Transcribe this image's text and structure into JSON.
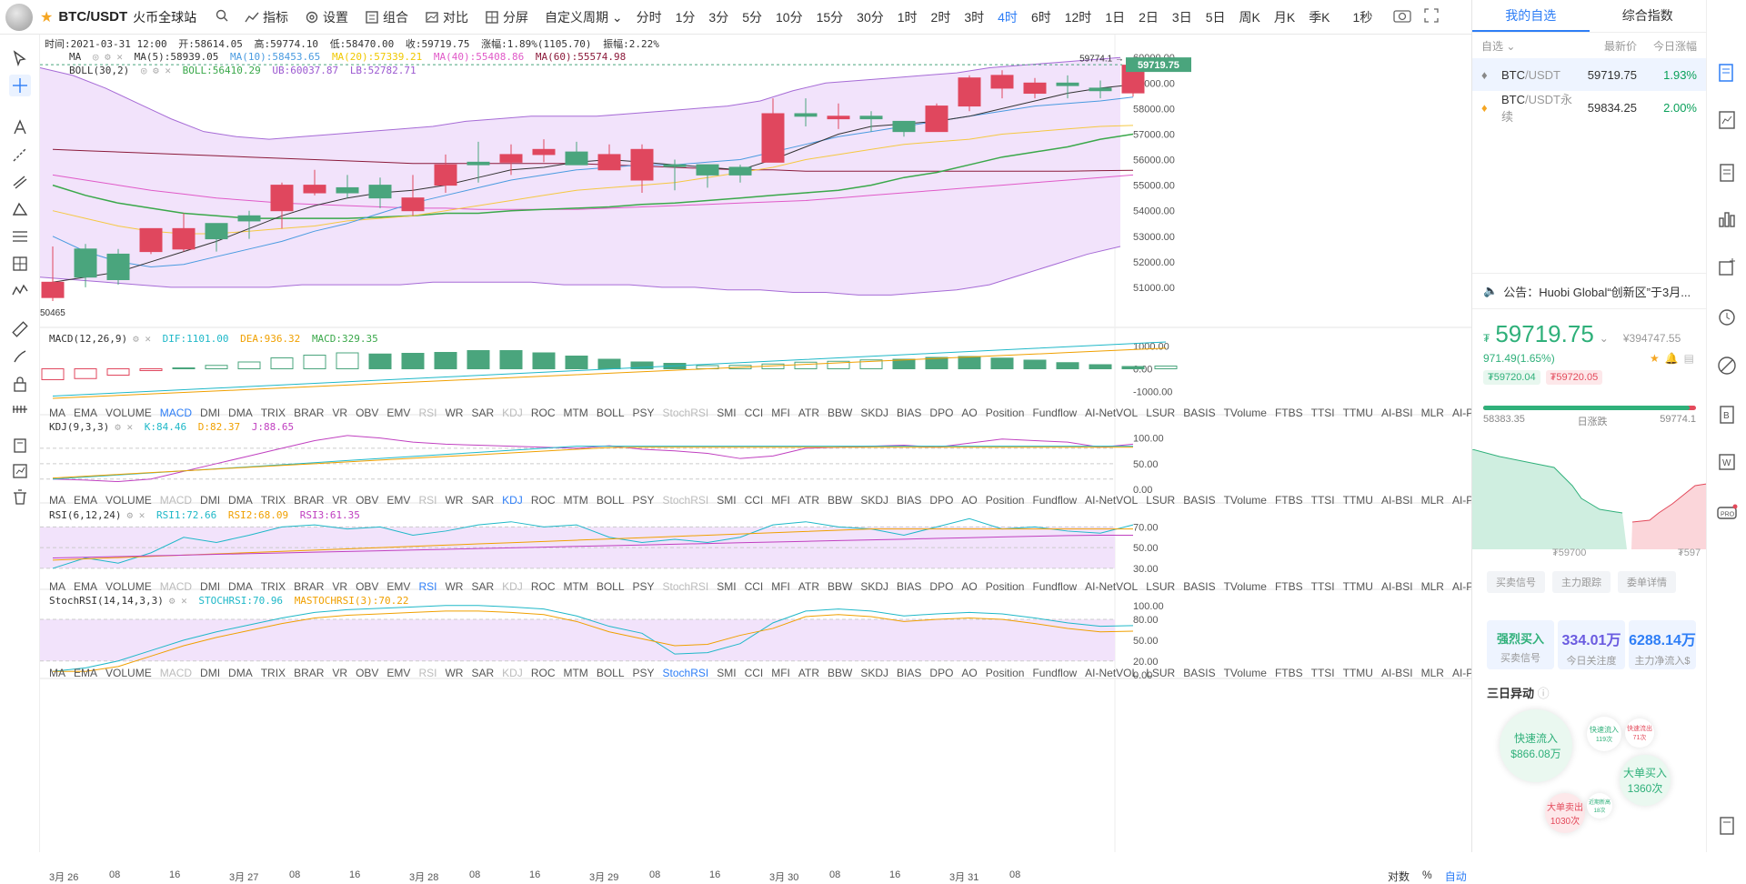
{
  "topbar": {
    "symbol": "BTC/USDT",
    "exchange": "火币全球站",
    "tools": [
      "指标",
      "设置",
      "组合",
      "对比",
      "分屏"
    ],
    "custom_period": "自定义周期",
    "periods": [
      "分时",
      "1分",
      "3分",
      "5分",
      "10分",
      "15分",
      "30分",
      "1时",
      "2时",
      "3时",
      "4时",
      "6时",
      "12时",
      "1日",
      "2日",
      "3日",
      "5日",
      "周K",
      "月K",
      "季K"
    ],
    "active_period": "4时",
    "countdown": "1秒"
  },
  "ohlc_line": {
    "time": "时间:2021-03-31 12:00",
    "open": "开:58614.05",
    "high": "高:59774.10",
    "low": "低:58470.00",
    "close": "收:59719.75",
    "change": "涨幅:1.89%(1105.70)",
    "amp": "振幅:2.22%"
  },
  "ma_line": {
    "name": "MA",
    "ma5": "MA(5):58939.05",
    "ma10": "MA(10):58453.65",
    "ma20": "MA(20):57339.21",
    "ma40": "MA(40):55408.86",
    "ma60": "MA(60):55574.98"
  },
  "boll_line": {
    "name": "BOLL(30,2)",
    "boll": "BOLL:56410.29",
    "ub": "UB:60037.87",
    "lb": "LB:52782.71"
  },
  "macd_line": {
    "name": "MACD(12,26,9)",
    "dif": "DIF:1101.00",
    "dea": "DEA:936.32",
    "macd": "MACD:329.35"
  },
  "kdj_line": {
    "name": "KDJ(9,3,3)",
    "k": "K:84.46",
    "d": "D:82.37",
    "j": "J:88.65"
  },
  "rsi_line": {
    "name": "RSI(6,12,24)",
    "r1": "RSI1:72.66",
    "r2": "RSI2:68.09",
    "r3": "RSI3:61.35"
  },
  "stoch_line": {
    "name": "StochRSI(14,14,3,3)",
    "s": "STOCHRSI:70.96",
    "m": "MASTOCHRSI(3):70.22"
  },
  "indicator_tabs": [
    "MA",
    "EMA",
    "VOLUME",
    "MACD",
    "DMI",
    "DMA",
    "TRIX",
    "BRAR",
    "VR",
    "OBV",
    "EMV",
    "RSI",
    "WR",
    "SAR",
    "KDJ",
    "ROC",
    "MTM",
    "BOLL",
    "PSY",
    "StochRSI",
    "SMI",
    "CCI",
    "MFI",
    "ATR",
    "BBW",
    "SKDJ",
    "BIAS",
    "DPO",
    "AO",
    "Position",
    "Fundflow",
    "AI-NetVOL",
    "LSUR",
    "BASIS",
    "TVolume",
    "FTBS",
    "TTSI",
    "TTMU",
    "AI-BSI",
    "MLR",
    "AI-PD"
  ],
  "price_axis": [
    "60000.00",
    "59000.00",
    "58000.00",
    "57000.00",
    "56000.00",
    "55000.00",
    "54000.00",
    "53000.00",
    "52000.00",
    "51000.00"
  ],
  "price_tag": "59719.75",
  "high_mark": "59774.1",
  "low_mark": "50465",
  "macd_axis": [
    "1000.00",
    "0.00",
    "-1000.00"
  ],
  "kdj_axis": [
    "100.00",
    "50.00",
    "0.00"
  ],
  "rsi_axis": [
    "70.00",
    "50.00",
    "30.00"
  ],
  "stoch_axis": [
    "100.00",
    "80.00",
    "50.00",
    "20.00",
    "0.00"
  ],
  "x_labels": [
    "3月 26",
    "08",
    "16",
    "3月 27",
    "08",
    "16",
    "3月 28",
    "08",
    "16",
    "3月 29",
    "08",
    "16",
    "3月 30",
    "08",
    "16",
    "3月 31",
    "08"
  ],
  "bottom_right": {
    "a": "对数",
    "b": "%",
    "c": "自动"
  },
  "chart_data": {
    "type": "candlestick",
    "candles": [
      [
        51200,
        50465,
        52600,
        50600
      ],
      [
        51400,
        51000,
        52700,
        52500
      ],
      [
        51300,
        51100,
        52500,
        52300
      ],
      [
        53300,
        52300,
        53300,
        52400
      ],
      [
        53300,
        52400,
        53900,
        52500
      ],
      [
        52900,
        52400,
        53200,
        53500
      ],
      [
        53600,
        52900,
        54000,
        53800
      ],
      [
        55000,
        53300,
        55100,
        54000
      ],
      [
        55000,
        54600,
        55600,
        54700
      ],
      [
        54700,
        54500,
        55400,
        54900
      ],
      [
        54500,
        54100,
        55300,
        55000
      ],
      [
        54500,
        53800,
        55400,
        54000
      ],
      [
        55800,
        54700,
        56200,
        55000
      ],
      [
        55800,
        55100,
        56700,
        55900
      ],
      [
        56200,
        55400,
        56600,
        55900
      ],
      [
        56400,
        55900,
        56800,
        56200
      ],
      [
        55800,
        55800,
        56700,
        56300
      ],
      [
        56200,
        55600,
        56600,
        55600
      ],
      [
        56400,
        54700,
        56600,
        55200
      ],
      [
        55800,
        54800,
        56000,
        55800
      ],
      [
        55400,
        54900,
        55700,
        55800
      ],
      [
        55400,
        55100,
        55800,
        55700
      ],
      [
        57800,
        55900,
        58400,
        55900
      ],
      [
        57700,
        57300,
        58400,
        57800
      ],
      [
        57700,
        57200,
        58200,
        57600
      ],
      [
        57600,
        57100,
        57900,
        57700
      ],
      [
        57100,
        56900,
        57400,
        57500
      ],
      [
        58100,
        57100,
        58200,
        57100
      ],
      [
        59200,
        57900,
        59300,
        58100
      ],
      [
        59300,
        58400,
        59500,
        58800
      ],
      [
        59000,
        58400,
        59200,
        58600
      ],
      [
        58900,
        58400,
        59300,
        59000
      ],
      [
        58700,
        58400,
        59100,
        58800
      ],
      [
        59700,
        58470,
        59774,
        58614
      ]
    ],
    "volume_macd": [
      -480,
      -430,
      -280,
      -80,
      40,
      150,
      300,
      480,
      600,
      700,
      650,
      680,
      720,
      800,
      800,
      700,
      560,
      420,
      300,
      240,
      140,
      150,
      210,
      290,
      330,
      390,
      420,
      500,
      540,
      470,
      380,
      270,
      180,
      100,
      120
    ]
  },
  "watchlist": {
    "tabs": [
      "我的自选",
      "综合指数"
    ],
    "header": {
      "name": "自选",
      "price": "最新价",
      "change": "今日涨幅"
    },
    "rows": [
      {
        "base": "BTC",
        "quote": "/USDT",
        "price": "59719.75",
        "change": "1.93%"
      },
      {
        "base": "BTC",
        "quote": "/USDT永续",
        "price": "59834.25",
        "change": "2.00%"
      }
    ]
  },
  "notice": "公告：Huobi Global“创新区”于3月...",
  "ticker": {
    "price": "59719.75",
    "cny": "¥394747.55",
    "change": "971.49(1.65%)",
    "bid": "₮59720.04",
    "ask": "₮59720.05",
    "low": "58383.35",
    "range_label": "日涨跌",
    "high": "59774.1",
    "depth_bid": "₮59700",
    "depth_ask": "₮597"
  },
  "signal_tabs": [
    "买卖信号",
    "主力跟踪",
    "委单详情"
  ],
  "stats": [
    {
      "value": "强烈买入",
      "label": "买卖信号"
    },
    {
      "value": "334.01万",
      "label": "今日关注度"
    },
    {
      "value": "6288.14万",
      "label": "主力净流入$"
    }
  ],
  "three_day": {
    "title": "三日异动",
    "b1": "快速流入",
    "b1v": "$866.08万",
    "b2": "快速流入",
    "b2v": "119次",
    "b3": "快速流出",
    "b3v": "71次",
    "b4": "大单买入",
    "b4v": "1360次",
    "b5": "大单卖出",
    "b5v": "1030次",
    "b6": "近期新高",
    "b6v": "18次"
  }
}
